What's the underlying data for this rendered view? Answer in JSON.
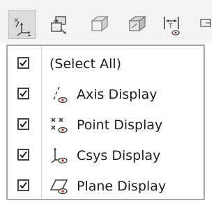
{
  "toolbar": {
    "buttons": [
      {
        "icon": "axis-point-csys-display-icon",
        "active": true
      },
      {
        "icon": "copy-to-layer-icon",
        "active": false
      },
      {
        "icon": "show-solid-box-icon",
        "active": false
      },
      {
        "icon": "hide-solid-box-icon",
        "active": false
      },
      {
        "icon": "dimension-display-icon",
        "active": false
      },
      {
        "icon": "more-icon",
        "active": false
      }
    ]
  },
  "menu": {
    "items": [
      {
        "label": "(Select All)",
        "checked": true
      },
      {
        "label": "Axis Display",
        "checked": true,
        "icon": "axis-display-icon"
      },
      {
        "label": "Point Display",
        "checked": true,
        "icon": "point-display-icon"
      },
      {
        "label": "Csys Display",
        "checked": true,
        "icon": "csys-display-icon"
      },
      {
        "label": "Plane Display",
        "checked": true,
        "icon": "plane-display-icon"
      }
    ]
  },
  "colors": {
    "toolbar_bg": "#f3f3f3",
    "menu_border": "#a8a8a8",
    "eye_red": "#c0392b"
  }
}
